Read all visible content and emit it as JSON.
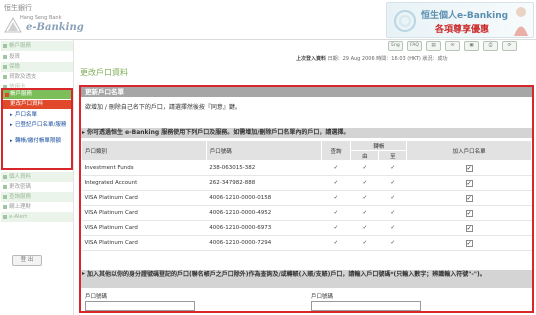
{
  "header": {
    "brand_cn": "恒生銀行",
    "brand_en": "Hang Seng Bank",
    "product": "e-Banking",
    "promo_line1": "恒生個人e-Banking",
    "promo_line2": "各項尊享優惠"
  },
  "sidebar": {
    "items": [
      {
        "label": "帳戶服務"
      },
      {
        "label": "投資"
      },
      {
        "label": "保險"
      },
      {
        "label": "貸款及透支"
      },
      {
        "label": "信用卡"
      }
    ],
    "group": {
      "label": "帳戶服務",
      "sub_label": "更改戶口資料",
      "links": [
        {
          "label": "戶口名單"
        },
        {
          "label": "已登記戶口名單/服務"
        },
        {
          "label": "轉帳/繳付帳單限額"
        }
      ]
    },
    "more_items": [
      {
        "label": "個人資料"
      },
      {
        "label": "更改密碼"
      },
      {
        "label": "查詢服務"
      },
      {
        "label": "網上理財"
      },
      {
        "label": "e-Alert"
      }
    ],
    "logout_label": "登 出"
  },
  "toolbar": {
    "buttons": [
      {
        "label": "Eng",
        "icon": "lang-icon"
      },
      {
        "label": "FAQ",
        "icon": "faq-icon"
      },
      {
        "label": "▤",
        "icon": "sitemap-icon"
      },
      {
        "label": "✉",
        "icon": "mail-icon"
      },
      {
        "label": "▣",
        "icon": "calendar-icon"
      },
      {
        "label": "⎙",
        "icon": "print-icon"
      },
      {
        "label": "⟳",
        "icon": "refresh-icon"
      }
    ]
  },
  "session": {
    "last_login_label": "上次登入資料",
    "date_label": "日期：",
    "date_value": "29 Aug 2006",
    "time_label": "時間：",
    "time_value": "16:03 (HKT)",
    "status_label": "狀況：",
    "status_value": "成功"
  },
  "page": {
    "title": "更改戶口資料",
    "panel_title": "更新戶口名單",
    "instruction": "欲增加 / 刪除自己名下的戶口，請選擇然後按『同意』鍵。",
    "section1": "你可透過恒生 e-Banking 服務使用下列戶口及服務。如需增加/刪除戶口名單內的戶口，請選擇。",
    "section2": "加入其他以你的身分證號碼登記的戶口(聯名帳戶之戶口除外)作為查詢及/或轉賬(入賬/支賬)戶口，請輸入戶口號碼*(只輸入數字；辨識輸入符號\"-\")。"
  },
  "table": {
    "headers": {
      "type": "戶口類別",
      "number": "戶口號碼",
      "enquiry": "查詢",
      "transfer": "轉帳",
      "transfer_in": "由",
      "transfer_out": "至",
      "add": "加入戶口名單"
    },
    "rows": [
      {
        "type": "Investment Funds",
        "number": "238-063015-382",
        "enquiry": "✓",
        "tin": "✓",
        "tout": "✓",
        "add": "✓"
      },
      {
        "type": "Integrated Account",
        "number": "262-347982-888",
        "enquiry": "✓",
        "tin": "✓",
        "tout": "✓",
        "add": "✓"
      },
      {
        "type": "VISA Platinum Card",
        "number": "4006-1210-0000-0158",
        "enquiry": "✓",
        "tin": "✓",
        "tout": "✓",
        "add": "✓"
      },
      {
        "type": "VISA Platinum Card",
        "number": "4006-1210-0000-4952",
        "enquiry": "✓",
        "tin": "✓",
        "tout": "✓",
        "add": "✓"
      },
      {
        "type": "VISA Platinum Card",
        "number": "4006-1210-0000-6973",
        "enquiry": "✓",
        "tin": "✓",
        "tout": "✓",
        "add": "✓"
      },
      {
        "type": "VISA Platinum Card",
        "number": "4006-1210-0000-7294",
        "enquiry": "✓",
        "tin": "✓",
        "tout": "✓",
        "add": "✓"
      }
    ]
  },
  "form": {
    "account_label_1": "戶口號碼",
    "account_label_2": "戶口號碼"
  },
  "colors": {
    "highlight": "#d8262a",
    "brand_green": "#7cbf5a"
  }
}
